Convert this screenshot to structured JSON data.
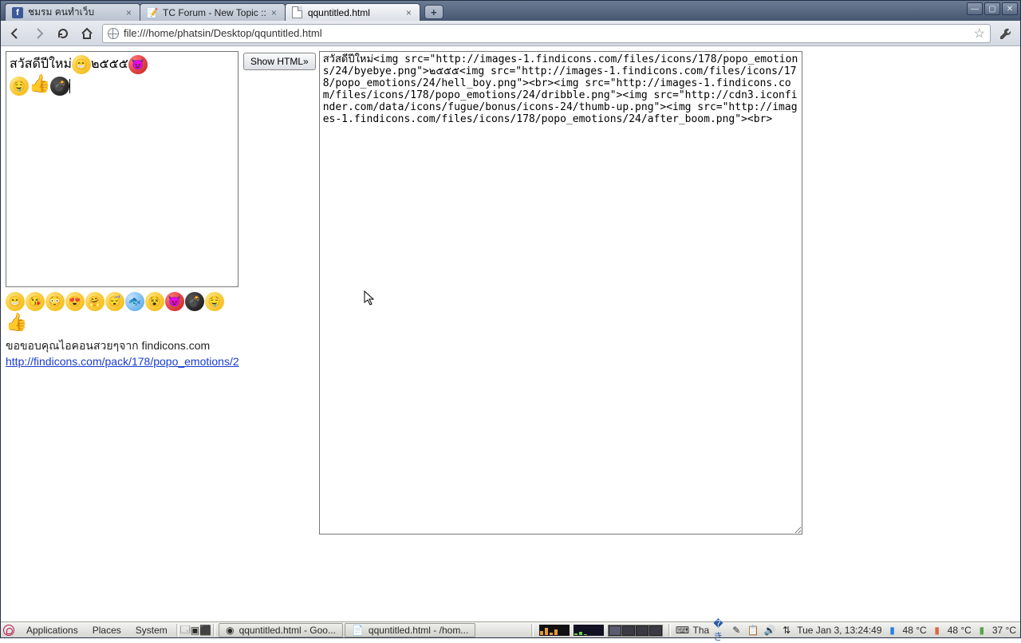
{
  "window": {
    "tabs": [
      {
        "title": "ชมรม คนทำเว็บ",
        "kind": "facebook"
      },
      {
        "title": "TC Forum - New Topic ::",
        "kind": "generic"
      },
      {
        "title": "qquntitled.html",
        "kind": "page"
      }
    ],
    "active_tab_index": 2,
    "url": "file:///home/phatsin/Desktop/qquntitled.html"
  },
  "page": {
    "editor": {
      "line1_prefix": "สวัสดีปีใหม่",
      "line1_suffix": "๒๕๕๕"
    },
    "show_html_button": "Show HTML»",
    "html_output": "สวัสดีปีใหม่<img src=\"http://images-1.findicons.com/files/icons/178/popo_emotions/24/byebye.png\">๒๕๕๕<img src=\"http://images-1.findicons.com/files/icons/178/popo_emotions/24/hell_boy.png\"><br><img src=\"http://images-1.findicons.com/files/icons/178/popo_emotions/24/dribble.png\"><img src=\"http://cdn3.iconfinder.com/data/icons/fugue/bonus/icons-24/thumb-up.png\"><img src=\"http://images-1.findicons.com/files/icons/178/popo_emotions/24/after_boom.png\"><br>",
    "credits_text": "ขอขอบคุณไอคอนสวยๆจาก findicons.com",
    "credits_link": "http://findicons.com/pack/178/popo_emotions/2"
  },
  "panel": {
    "menus": [
      "Applications",
      "Places",
      "System"
    ],
    "tasks": [
      "qquntitled.html - Goo...",
      "qquntitled.html - /hom..."
    ],
    "ime": "Tha",
    "clock": "Tue Jan  3, 13:24:49",
    "temp1": "48 °C",
    "temp2": "48 °C",
    "temp3": "37 °C"
  }
}
